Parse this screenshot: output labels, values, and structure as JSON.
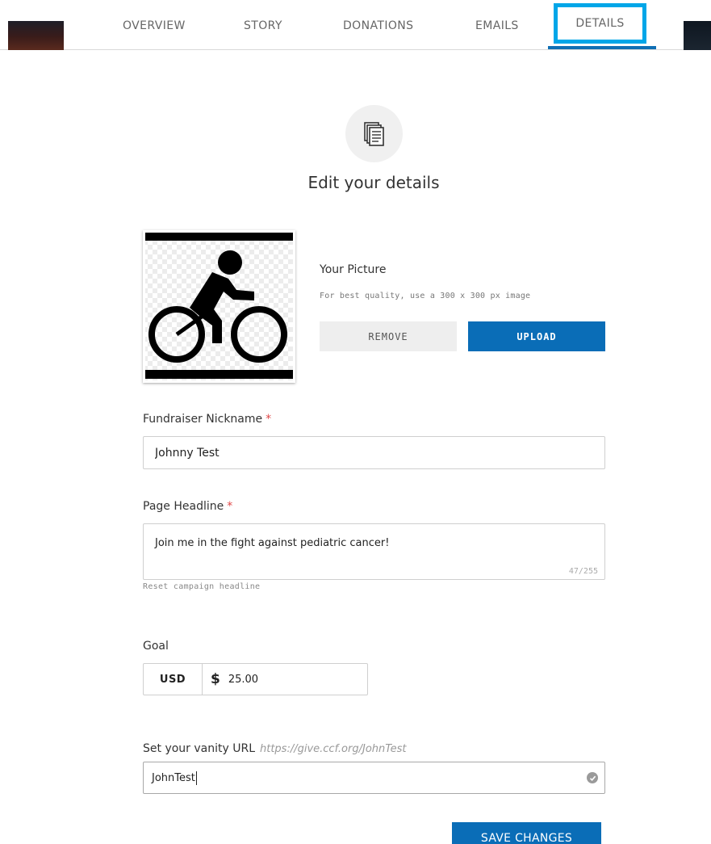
{
  "nav": {
    "tabs": [
      {
        "label": "OVERVIEW"
      },
      {
        "label": "STORY"
      },
      {
        "label": "DONATIONS"
      },
      {
        "label": "EMAILS"
      },
      {
        "label": "DETAILS"
      }
    ],
    "active_tab": "DETAILS"
  },
  "header": {
    "icon": "documents-icon",
    "title": "Edit your details"
  },
  "picture": {
    "label": "Your Picture",
    "hint": "For best quality, use a 300 x 300 px image",
    "image": "cyclist-icon",
    "remove_label": "REMOVE",
    "upload_label": "UPLOAD"
  },
  "form": {
    "nickname": {
      "label": "Fundraiser Nickname",
      "required_mark": "*",
      "value": "Johnny Test"
    },
    "headline": {
      "label": "Page Headline",
      "required_mark": "*",
      "value": "Join me in the fight against pediatric cancer!",
      "counter": "47/255",
      "reset_label": "Reset campaign headline"
    },
    "goal": {
      "label": "Goal",
      "currency": "USD",
      "currency_symbol": "$",
      "value": "25.00"
    },
    "vanity": {
      "label": "Set your vanity URL",
      "url_hint": "https://give.ccf.org/JohnTest",
      "value": "JohnTest",
      "status_icon": "check-circle-icon"
    }
  },
  "save_label": "SAVE CHANGES",
  "colors": {
    "primary": "#0a6db7",
    "highlight": "#00a6e8",
    "required": "#e04848"
  }
}
